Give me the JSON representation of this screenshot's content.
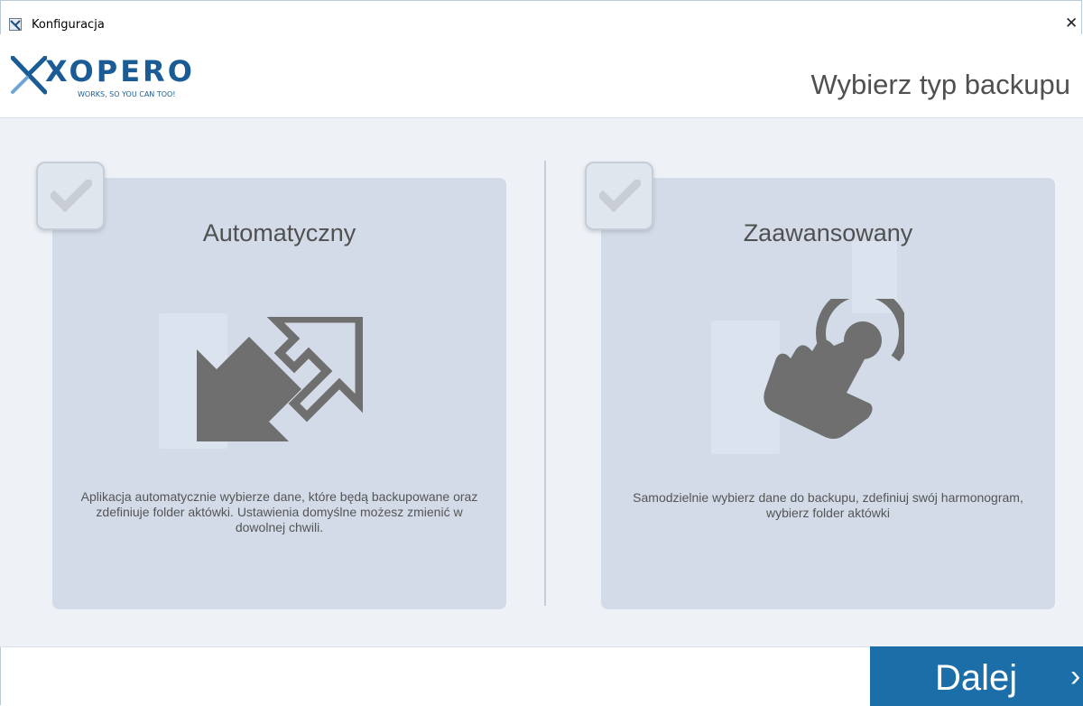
{
  "window": {
    "title": "Konfiguracja"
  },
  "header": {
    "logo_text": "XOPERO",
    "logo_tagline": "WORKS, SO YOU CAN TOO!",
    "page_title": "Wybierz typ backupu"
  },
  "options": [
    {
      "title": "Automatyczny",
      "description": "Aplikacja automatycznie wybierze dane, które będą backupowane oraz zdefiniuje folder aktówki. Ustawienia domyślne możesz zmienić w dowolnej chwili.",
      "icon": "expand-arrows-icon",
      "checked": false
    },
    {
      "title": "Zaawansowany",
      "description": "Samodzielnie wybierz dane do backupu, zdefiniuj swój harmonogram, wybierz folder aktówki",
      "icon": "hand-pointer-icon",
      "checked": false
    }
  ],
  "footer": {
    "next_label": "Dalej",
    "next_icon": "chevron-right-icon"
  },
  "colors": {
    "accent": "#1c6ea9",
    "card": "#d2dbe7",
    "background": "#eef2f7",
    "logo": "#1b5c96"
  }
}
